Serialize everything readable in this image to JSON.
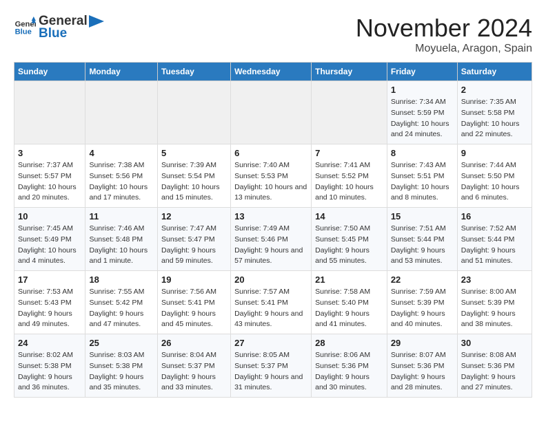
{
  "logo": {
    "line1": "General",
    "line2": "Blue"
  },
  "title": "November 2024",
  "location": "Moyuela, Aragon, Spain",
  "days_of_week": [
    "Sunday",
    "Monday",
    "Tuesday",
    "Wednesday",
    "Thursday",
    "Friday",
    "Saturday"
  ],
  "weeks": [
    [
      {
        "day": "",
        "info": ""
      },
      {
        "day": "",
        "info": ""
      },
      {
        "day": "",
        "info": ""
      },
      {
        "day": "",
        "info": ""
      },
      {
        "day": "",
        "info": ""
      },
      {
        "day": "1",
        "info": "Sunrise: 7:34 AM\nSunset: 5:59 PM\nDaylight: 10 hours and 24 minutes."
      },
      {
        "day": "2",
        "info": "Sunrise: 7:35 AM\nSunset: 5:58 PM\nDaylight: 10 hours and 22 minutes."
      }
    ],
    [
      {
        "day": "3",
        "info": "Sunrise: 7:37 AM\nSunset: 5:57 PM\nDaylight: 10 hours and 20 minutes."
      },
      {
        "day": "4",
        "info": "Sunrise: 7:38 AM\nSunset: 5:56 PM\nDaylight: 10 hours and 17 minutes."
      },
      {
        "day": "5",
        "info": "Sunrise: 7:39 AM\nSunset: 5:54 PM\nDaylight: 10 hours and 15 minutes."
      },
      {
        "day": "6",
        "info": "Sunrise: 7:40 AM\nSunset: 5:53 PM\nDaylight: 10 hours and 13 minutes."
      },
      {
        "day": "7",
        "info": "Sunrise: 7:41 AM\nSunset: 5:52 PM\nDaylight: 10 hours and 10 minutes."
      },
      {
        "day": "8",
        "info": "Sunrise: 7:43 AM\nSunset: 5:51 PM\nDaylight: 10 hours and 8 minutes."
      },
      {
        "day": "9",
        "info": "Sunrise: 7:44 AM\nSunset: 5:50 PM\nDaylight: 10 hours and 6 minutes."
      }
    ],
    [
      {
        "day": "10",
        "info": "Sunrise: 7:45 AM\nSunset: 5:49 PM\nDaylight: 10 hours and 4 minutes."
      },
      {
        "day": "11",
        "info": "Sunrise: 7:46 AM\nSunset: 5:48 PM\nDaylight: 10 hours and 1 minute."
      },
      {
        "day": "12",
        "info": "Sunrise: 7:47 AM\nSunset: 5:47 PM\nDaylight: 9 hours and 59 minutes."
      },
      {
        "day": "13",
        "info": "Sunrise: 7:49 AM\nSunset: 5:46 PM\nDaylight: 9 hours and 57 minutes."
      },
      {
        "day": "14",
        "info": "Sunrise: 7:50 AM\nSunset: 5:45 PM\nDaylight: 9 hours and 55 minutes."
      },
      {
        "day": "15",
        "info": "Sunrise: 7:51 AM\nSunset: 5:44 PM\nDaylight: 9 hours and 53 minutes."
      },
      {
        "day": "16",
        "info": "Sunrise: 7:52 AM\nSunset: 5:44 PM\nDaylight: 9 hours and 51 minutes."
      }
    ],
    [
      {
        "day": "17",
        "info": "Sunrise: 7:53 AM\nSunset: 5:43 PM\nDaylight: 9 hours and 49 minutes."
      },
      {
        "day": "18",
        "info": "Sunrise: 7:55 AM\nSunset: 5:42 PM\nDaylight: 9 hours and 47 minutes."
      },
      {
        "day": "19",
        "info": "Sunrise: 7:56 AM\nSunset: 5:41 PM\nDaylight: 9 hours and 45 minutes."
      },
      {
        "day": "20",
        "info": "Sunrise: 7:57 AM\nSunset: 5:41 PM\nDaylight: 9 hours and 43 minutes."
      },
      {
        "day": "21",
        "info": "Sunrise: 7:58 AM\nSunset: 5:40 PM\nDaylight: 9 hours and 41 minutes."
      },
      {
        "day": "22",
        "info": "Sunrise: 7:59 AM\nSunset: 5:39 PM\nDaylight: 9 hours and 40 minutes."
      },
      {
        "day": "23",
        "info": "Sunrise: 8:00 AM\nSunset: 5:39 PM\nDaylight: 9 hours and 38 minutes."
      }
    ],
    [
      {
        "day": "24",
        "info": "Sunrise: 8:02 AM\nSunset: 5:38 PM\nDaylight: 9 hours and 36 minutes."
      },
      {
        "day": "25",
        "info": "Sunrise: 8:03 AM\nSunset: 5:38 PM\nDaylight: 9 hours and 35 minutes."
      },
      {
        "day": "26",
        "info": "Sunrise: 8:04 AM\nSunset: 5:37 PM\nDaylight: 9 hours and 33 minutes."
      },
      {
        "day": "27",
        "info": "Sunrise: 8:05 AM\nSunset: 5:37 PM\nDaylight: 9 hours and 31 minutes."
      },
      {
        "day": "28",
        "info": "Sunrise: 8:06 AM\nSunset: 5:36 PM\nDaylight: 9 hours and 30 minutes."
      },
      {
        "day": "29",
        "info": "Sunrise: 8:07 AM\nSunset: 5:36 PM\nDaylight: 9 hours and 28 minutes."
      },
      {
        "day": "30",
        "info": "Sunrise: 8:08 AM\nSunset: 5:36 PM\nDaylight: 9 hours and 27 minutes."
      }
    ]
  ]
}
